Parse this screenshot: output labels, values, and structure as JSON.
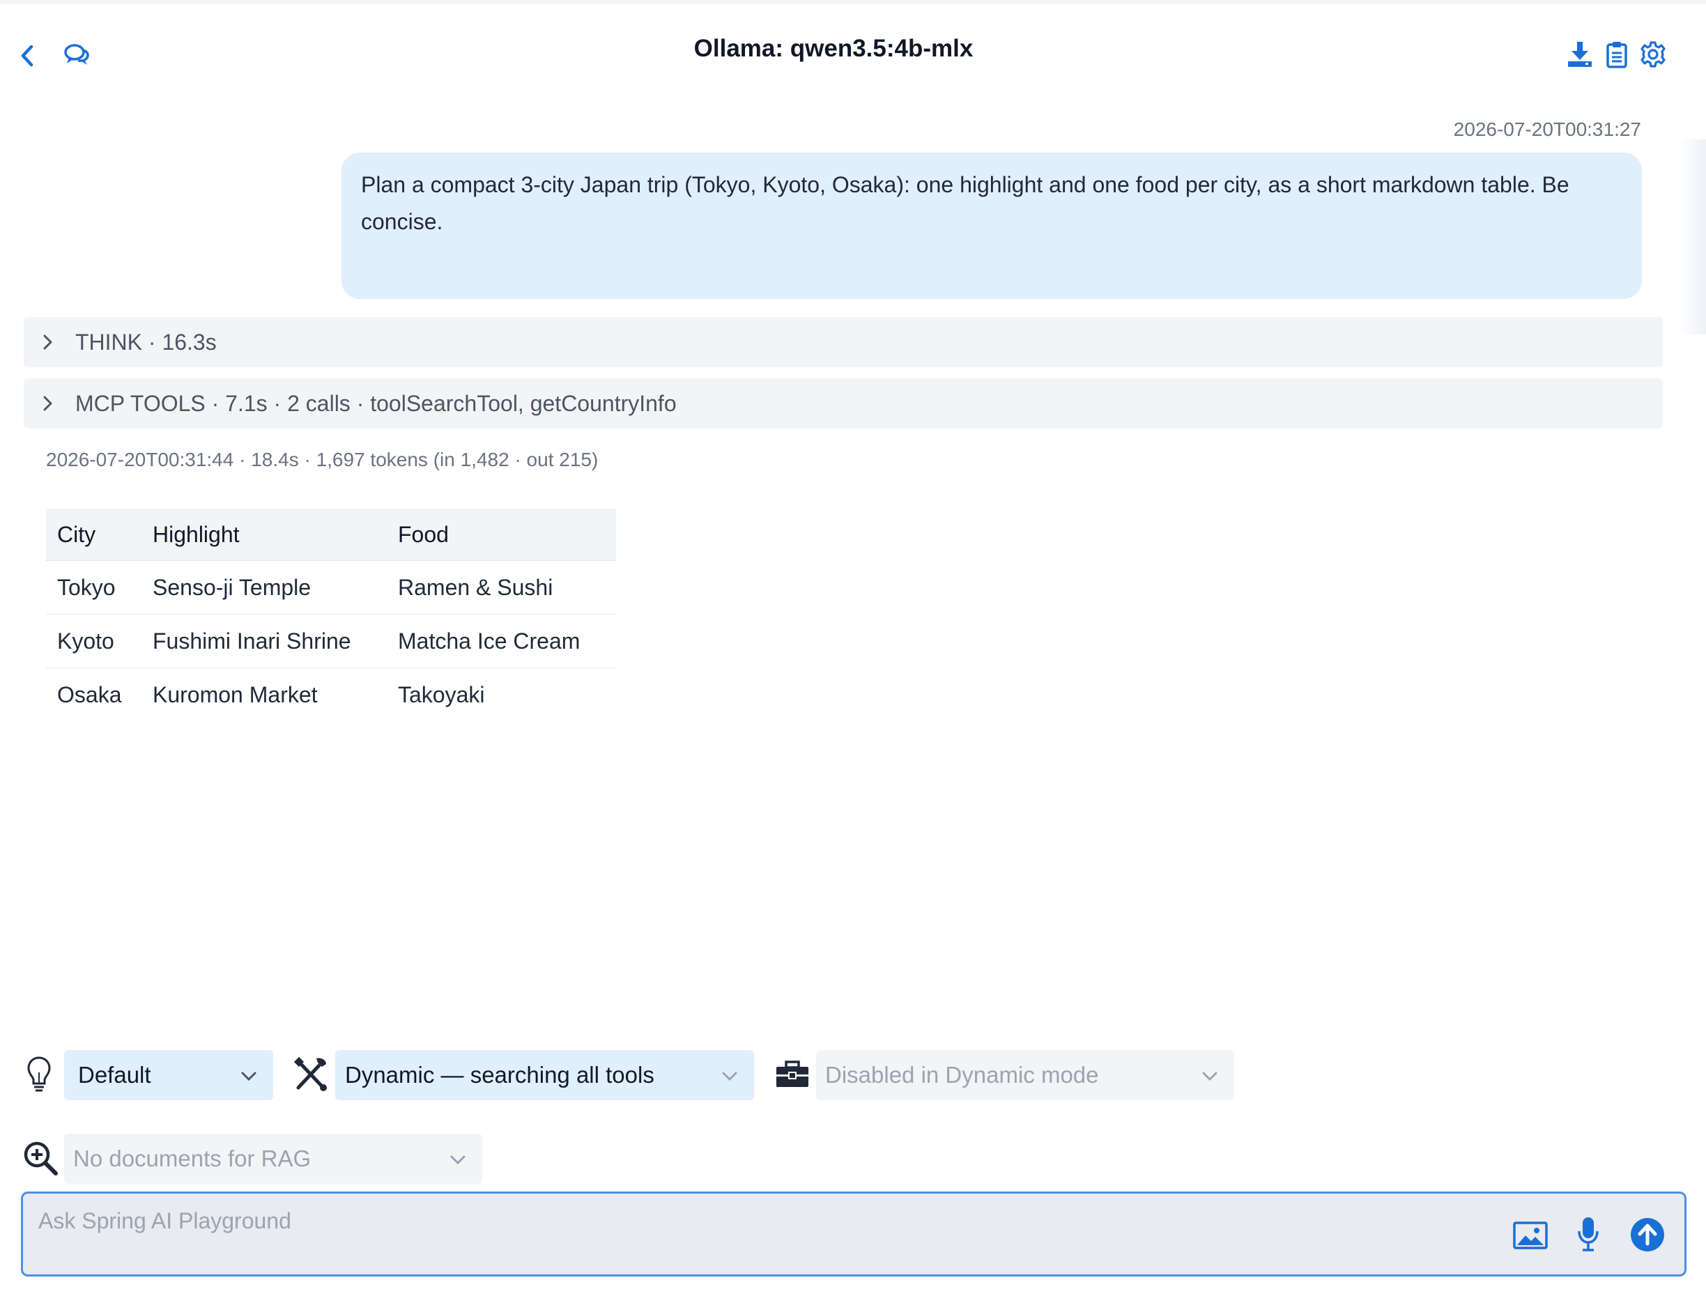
{
  "header": {
    "title": "Ollama: qwen3.5:4b-mlx",
    "icons": [
      "back-chevron-icon",
      "chat-bubbles-icon",
      "download-icon",
      "clipboard-icon",
      "gear-icon"
    ]
  },
  "colors": {
    "accent": "#1a6fd6",
    "user_bubble": "#e1eefc",
    "panel_gray": "#f3f4f6"
  },
  "conversation": {
    "user_message": {
      "timestamp": "2026-07-20T00:31:27",
      "text": "Plan a compact 3-city Japan trip (Tokyo, Kyoto, Osaka): one highlight and one food per city, as a short markdown table. Be concise."
    },
    "think": {
      "label": "THINK · 16.3s"
    },
    "mcp_tools": {
      "label": "MCP TOOLS · 7.1s · 2 calls · toolSearchTool, getCountryInfo"
    },
    "assistant": {
      "meta": "2026-07-20T00:31:44 · 18.4s · 1,697 tokens (in 1,482 · out 215)",
      "table": {
        "headers": [
          "City",
          "Highlight",
          "Food"
        ],
        "rows": [
          [
            "Tokyo",
            "Senso-ji Temple",
            "Ramen & Sushi"
          ],
          [
            "Kyoto",
            "Fushimi Inari Shrine",
            "Matcha Ice Cream"
          ],
          [
            "Osaka",
            "Kuromon Market",
            "Takoyaki"
          ]
        ]
      }
    }
  },
  "controls": {
    "prompt_select": {
      "value": "Default",
      "icon": "lightbulb-icon"
    },
    "tools_select": {
      "value": "Dynamic — searching all tools",
      "icon": "tools-icon"
    },
    "toolbox_select": {
      "value": "Disabled in Dynamic mode",
      "icon": "toolbox-icon"
    },
    "rag_select": {
      "value": "No documents for RAG",
      "icon": "zoom-plus-icon"
    }
  },
  "chat_input": {
    "placeholder": "Ask Spring AI Playground",
    "icons": [
      "image-attach-icon",
      "microphone-icon",
      "send-arrow-icon"
    ]
  }
}
